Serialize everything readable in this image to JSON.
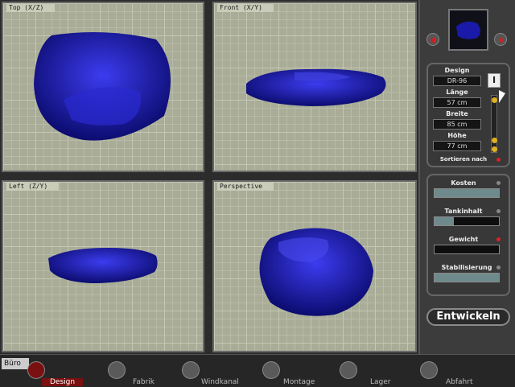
{
  "viewports": {
    "top_label": "Top (X/Z)",
    "front_label": "Front (X/Y)",
    "left_label": "Left (Z/Y)",
    "persp_label": "Perspective"
  },
  "design": {
    "design_label": "Design",
    "design_value": "DR-96",
    "laenge_label": "Länge",
    "laenge_value": "57 cm",
    "breite_label": "Breite",
    "breite_value": "85 cm",
    "hoehe_label": "Höhe",
    "hoehe_value": "77 cm",
    "sort_label": "Sortieren nach",
    "cursor_tool": "I"
  },
  "meters": [
    {
      "label": "Kosten",
      "level": 1.0
    },
    {
      "label": "Tankinhalt",
      "level": 0.3
    },
    {
      "label": "Gewicht",
      "level": 0.0
    },
    {
      "label": "Stabilisierung",
      "level": 1.0
    }
  ],
  "develop_button": "Entwickeln",
  "taskbar": {
    "buro": "Büro",
    "tabs": [
      "Design",
      "Fabrik",
      "Windkanal",
      "Montage",
      "Lager",
      "Abfahrt"
    ]
  },
  "colors": {
    "accent": "#7a1010",
    "model": "#1a1aa8",
    "led_red": "#e02020"
  }
}
